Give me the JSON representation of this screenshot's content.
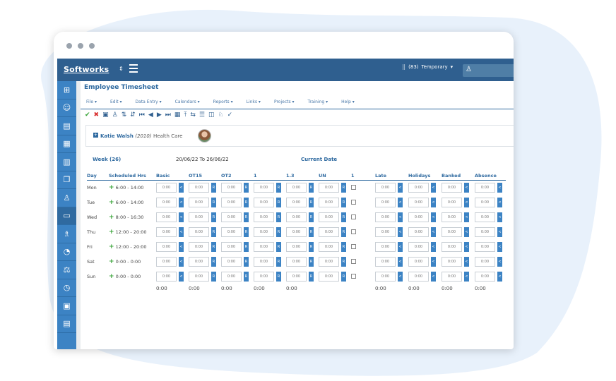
{
  "app": {
    "logo": "Softworks",
    "employee_count": "(83)",
    "employee_type": "Temporary",
    "page_title": "Employee Timesheet"
  },
  "menu": [
    "File ▾",
    "Edit ▾",
    "Data Entry ▾",
    "Calendars ▾",
    "Reports ▾",
    "Links ▾",
    "Projects ▾",
    "Training ▾",
    "Help ▾"
  ],
  "employee": {
    "name": "Katie Walsh",
    "number": "(2010)",
    "department": "Health Care"
  },
  "week": {
    "label": "Week (26)",
    "range": "20/06/22 To 26/06/22",
    "current_date_label": "Current Date"
  },
  "columns": [
    "Day",
    "Scheduled Hrs",
    "Basic",
    "OT15",
    "OT2",
    "1",
    "1.3",
    "UN",
    "1",
    "Late",
    "Holidays",
    "Banked",
    "Absence"
  ],
  "rows": [
    {
      "day": "Mon",
      "hours": "6:00 - 14:00"
    },
    {
      "day": "Tue",
      "hours": "6:00 - 14:00"
    },
    {
      "day": "Wed",
      "hours": "8:00 - 16:30"
    },
    {
      "day": "Thu",
      "hours": "12:00 - 20:00"
    },
    {
      "day": "Fri",
      "hours": "12:00 - 20:00"
    },
    {
      "day": "Sat",
      "hours": "0:00 - 0:00"
    },
    {
      "day": "Sun",
      "hours": "0:00 - 0:00"
    }
  ],
  "cell_value": "0:00",
  "btn_r": "R",
  "btn_lt": "<",
  "totals": [
    "0:00",
    "0:00",
    "0:00",
    "0:00",
    "0:00",
    "0:00",
    "0:00",
    "0:00",
    "0:00"
  ],
  "colors": {
    "topbar": "#2f5f8f",
    "sidebar": "#3c83c4",
    "accent": "#2f6aa0",
    "check": "#37a337",
    "cross": "#d93030"
  }
}
